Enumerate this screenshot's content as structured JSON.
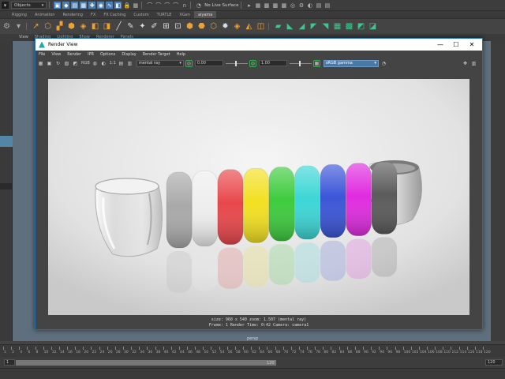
{
  "maya": {
    "mode_dropdown": "Objects",
    "live_surface": "No Live Surface",
    "shelf_tabs": [
      "Rigging",
      "Animation",
      "Rendering",
      "FX",
      "FX Caching",
      "Custom",
      "TURTLE",
      "XGen",
      "aiyama"
    ],
    "panel_menu": [
      "View",
      "Shading",
      "Lighting",
      "Show",
      "Renderer",
      "Panels"
    ],
    "viewport_label": "persp",
    "timeline_ticks": [
      "1",
      "2",
      "4",
      "6",
      "8",
      "10",
      "12",
      "14",
      "16",
      "18",
      "20",
      "22",
      "24",
      "26",
      "28",
      "30",
      "32",
      "34",
      "36",
      "38",
      "40",
      "42",
      "44",
      "46",
      "48",
      "50",
      "52",
      "54",
      "56",
      "58",
      "60",
      "62",
      "64",
      "66",
      "68",
      "70",
      "72",
      "74",
      "76",
      "78",
      "80",
      "82",
      "84",
      "86",
      "88",
      "90",
      "92",
      "94",
      "96",
      "98",
      "100",
      "102",
      "104",
      "106",
      "108",
      "110",
      "112",
      "114",
      "116",
      "118",
      "120"
    ],
    "range_start": "1",
    "range_end_left": "120",
    "range_end_right": "120",
    "current_frame": "1"
  },
  "render_view": {
    "title": "Render View",
    "window_buttons": {
      "minimize": "—",
      "maximize": "☐",
      "close": "✕"
    },
    "menu": [
      "File",
      "View",
      "Render",
      "IPR",
      "Options",
      "Display",
      "Render Target",
      "Help"
    ],
    "toolbar": {
      "ratio_label": "1:1",
      "renderer": "mental ray",
      "exposure": "0.00",
      "gamma": "1.00",
      "color_space": "sRGB gamma",
      "rgb_label": "RGB"
    },
    "status_line1": "size:  960 x 540  zoom: 1.507       (mental ray)",
    "status_line2": "Frame: 1       Render Time: 0:42       Camera: camera1"
  },
  "chart_data": null,
  "colors": {
    "rings": [
      "#a9a9a9",
      "#eeeeee",
      "#e8474b",
      "#f2e021",
      "#3ecb3e",
      "#3dd6d6",
      "#3b55d8",
      "#e02ce0",
      "#5b5b5b"
    ],
    "accent_blue": "#4b7fb5",
    "window_border": "#1e72b8"
  }
}
